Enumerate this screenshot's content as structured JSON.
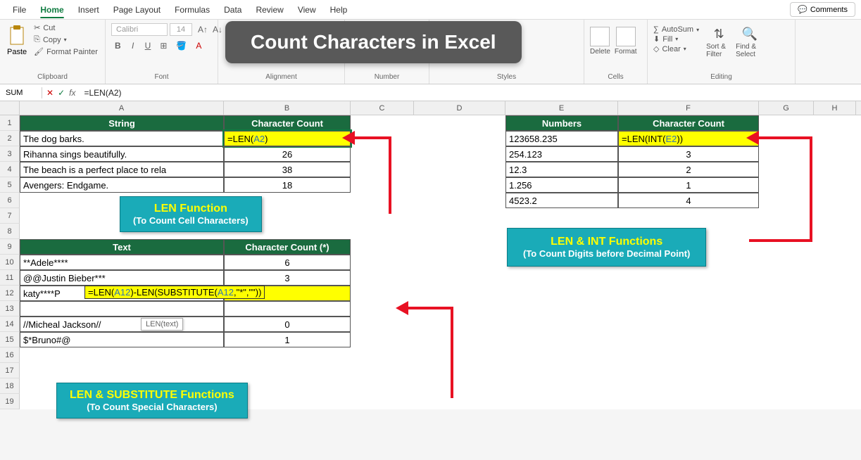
{
  "menubar": {
    "items": [
      "File",
      "Home",
      "Insert",
      "Page Layout",
      "Formulas",
      "Data",
      "Review",
      "View",
      "Help"
    ],
    "active": "Home",
    "comments": "Comments"
  },
  "ribbon": {
    "clipboard": {
      "label": "Clipboard",
      "paste": "Paste",
      "cut": "Cut",
      "copy": "Copy",
      "format_painter": "Format Painter"
    },
    "font": {
      "label": "Font",
      "name": "Calibri",
      "size": "14"
    },
    "alignment": {
      "label": "Alignment"
    },
    "number": {
      "label": "Number"
    },
    "styles": {
      "label": "Styles"
    },
    "cells": {
      "label": "Cells",
      "delete": "Delete",
      "format": "Format"
    },
    "editing": {
      "label": "Editing",
      "autosum": "AutoSum",
      "fill": "Fill",
      "clear": "Clear",
      "sort_filter": "Sort & Filter",
      "find_select": "Find & Select"
    }
  },
  "title_overlay": "Count Characters in Excel",
  "formula_bar": {
    "name_box": "SUM",
    "fx": "fx",
    "formula": "=LEN(A2)"
  },
  "columns": [
    "A",
    "B",
    "C",
    "D",
    "E",
    "F",
    "G",
    "H"
  ],
  "col_widths": {
    "A": 290,
    "B": 180,
    "C": 90,
    "D": 130,
    "E": 160,
    "F": 200,
    "G": 78,
    "H": 60
  },
  "table1": {
    "h1": "String",
    "h2": "Character Count",
    "rows": [
      {
        "a": "The dog barks.",
        "b_formula": "=LEN(A2)"
      },
      {
        "a": "Rihanna sings beautifully.",
        "b": "26"
      },
      {
        "a": "The beach is a perfect place to rela",
        "b": "38"
      },
      {
        "a": "Avengers: Endgame.",
        "b": "18"
      }
    ]
  },
  "table2": {
    "h1": "Text",
    "h2": "Character Count (*)",
    "rows": [
      {
        "a": "**Adele****",
        "b": "6"
      },
      {
        "a": " @@Justin Bieber***",
        "b": "3"
      },
      {
        "a": "katy****P",
        "b_formula_parts": [
          "=LEN(",
          "A12",
          ")-LEN(SUBSTITUTE(",
          "A12",
          ",\"*\",\"\"))"
        ]
      },
      {
        "a": "//Micheal Jackson//",
        "b": "0"
      },
      {
        "a": "$*Bruno#@",
        "b": "1"
      }
    ]
  },
  "table3": {
    "h1": "Numbers",
    "h2": "Character Count",
    "rows": [
      {
        "e": "123658.235",
        "f_formula_parts": [
          "=LEN(INT(",
          "E2",
          "))"
        ]
      },
      {
        "e": "254.123",
        "f": "3"
      },
      {
        "e": "12.3",
        "f": "2"
      },
      {
        "e": "1.256",
        "f": "1"
      },
      {
        "e": "4523.2",
        "f": "4"
      }
    ]
  },
  "callouts": {
    "c1": {
      "title": "LEN Function",
      "sub": "(To Count Cell Characters)"
    },
    "c2": {
      "title": "LEN & SUBSTITUTE Functions",
      "sub": "(To Count Special Characters)"
    },
    "c3": {
      "title": "LEN & INT Functions",
      "sub": "(To Count Digits before Decimal Point)"
    }
  },
  "tooltip": "LEN(text)",
  "chart_data": null
}
